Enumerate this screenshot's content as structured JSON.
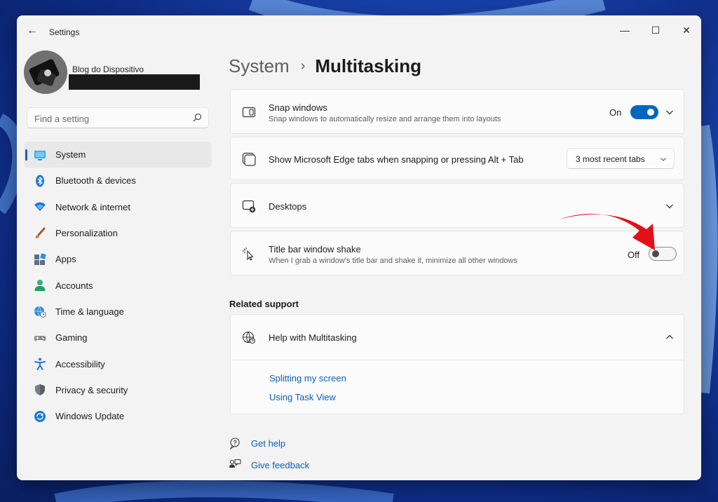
{
  "window": {
    "title": "Settings",
    "controls": {
      "minimize": "—",
      "maximize": "☐",
      "close": "✕"
    }
  },
  "profile": {
    "name": "Blog do Dispositivo"
  },
  "search": {
    "placeholder": "Find a setting"
  },
  "sidebar": {
    "items": [
      {
        "label": "System",
        "icon": "system-icon",
        "selected": true
      },
      {
        "label": "Bluetooth & devices",
        "icon": "bluetooth-icon",
        "selected": false
      },
      {
        "label": "Network & internet",
        "icon": "wifi-icon",
        "selected": false
      },
      {
        "label": "Personalization",
        "icon": "brush-icon",
        "selected": false
      },
      {
        "label": "Apps",
        "icon": "apps-icon",
        "selected": false
      },
      {
        "label": "Accounts",
        "icon": "person-icon",
        "selected": false
      },
      {
        "label": "Time & language",
        "icon": "globe-clock-icon",
        "selected": false
      },
      {
        "label": "Gaming",
        "icon": "gamepad-icon",
        "selected": false
      },
      {
        "label": "Accessibility",
        "icon": "accessibility-icon",
        "selected": false
      },
      {
        "label": "Privacy & security",
        "icon": "shield-icon",
        "selected": false
      },
      {
        "label": "Windows Update",
        "icon": "update-icon",
        "selected": false
      }
    ]
  },
  "breadcrumb": {
    "parent": "System",
    "separator": "›",
    "current": "Multitasking"
  },
  "settings": {
    "snap": {
      "title": "Snap windows",
      "description": "Snap windows to automatically resize and arrange them into layouts",
      "state_label": "On",
      "enabled": true
    },
    "edge_tabs": {
      "title": "Show Microsoft Edge tabs when snapping or pressing Alt + Tab",
      "selected": "3 most recent tabs"
    },
    "desktops": {
      "title": "Desktops"
    },
    "shake": {
      "title": "Title bar window shake",
      "description": "When I grab a window's title bar and shake it, minimize all other windows",
      "state_label": "Off",
      "enabled": false
    }
  },
  "related_support": {
    "heading": "Related support",
    "help_title": "Help with Multitasking",
    "links": [
      "Splitting my screen",
      "Using Task View"
    ]
  },
  "footer": {
    "get_help": "Get help",
    "give_feedback": "Give feedback"
  },
  "colors": {
    "accent": "#0067c0",
    "link": "#0a5fb4",
    "annotation_arrow": "#e3101a"
  }
}
